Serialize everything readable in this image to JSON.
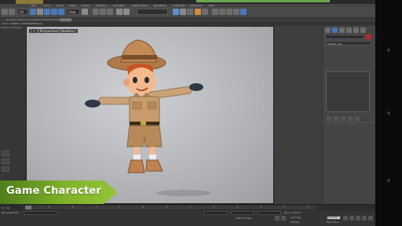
{
  "window": {
    "title": "Autodesk 3ds Max"
  },
  "menu": {
    "items": [
      "Edit",
      "Tools",
      "Group",
      "Views",
      "Create",
      "Modifiers",
      "Animation",
      "Graph Editors",
      "Rendering",
      "Customize",
      "MAXScript",
      "Help"
    ]
  },
  "toolbar": {
    "selection_filter": "All",
    "view_dropdown": "View"
  },
  "ribbon": {
    "tabs": [
      "Graphite Modeling Tools",
      "Freeform",
      "Selection",
      "Object Paint",
      "Populate"
    ],
    "active": "Populate"
  },
  "subribbon": {
    "labels": [
      "Define Flows",
      "Define Idle Areas",
      "Simulation",
      "Display"
    ]
  },
  "left_panel": {
    "label": "Polygon Modeling"
  },
  "viewport": {
    "label": "[ + ] [Perspective] [Realistic]"
  },
  "command_panel": {
    "name_field": "",
    "modifier_list": "Modifier List"
  },
  "status": {
    "frame": "0 / 100",
    "selected": "None Selected",
    "autokey": "Auto Key",
    "setkey": "Set Key",
    "selected_dropdown": "Selected",
    "key_filters": "Key Filters...",
    "grid": "Grid = 10.0cm",
    "add_time_tag": "Add Time Tag"
  },
  "overlay": {
    "banner_text": "Game Character"
  },
  "colors": {
    "banner_green": "#7fb22a",
    "viewport_bg": "#b6b8bc",
    "ui_dark": "#3a3a3a",
    "toolbar_blue": "#4a78b8"
  },
  "icons": [
    "undo-icon",
    "redo-icon",
    "select-icon",
    "move-icon",
    "rotate-icon",
    "scale-icon",
    "snap-icon",
    "render-icon",
    "create-tab-icon",
    "modify-tab-icon",
    "hierarchy-tab-icon",
    "motion-tab-icon",
    "display-tab-icon",
    "utilities-tab-icon",
    "play-icon"
  ]
}
